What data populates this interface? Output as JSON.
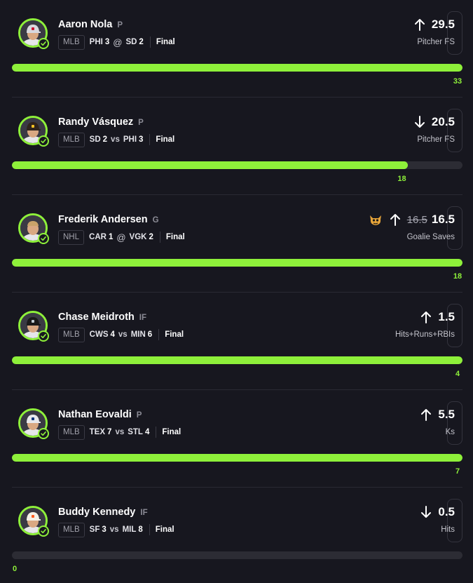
{
  "colors": {
    "background": "#17171f",
    "accent": "#8ef03a",
    "track": "#2c2c34",
    "box_border": "#34343e"
  },
  "cards": [
    {
      "player": "Aaron Nola",
      "position": "P",
      "league": "MLB",
      "team1": "PHI",
      "score1": "3",
      "separator": "@",
      "team2": "SD",
      "score2": "2",
      "status": "Final",
      "direction": "up",
      "direction_icon": "arrow-up-icon",
      "old_line": "",
      "line": "29.5",
      "stat": "Pitcher FS",
      "result": "33",
      "progress": 1.0,
      "headshot": "player-headshot-phillies-cap",
      "cap_color": "#d8d8de",
      "cap_accent": "#c8102e"
    },
    {
      "player": "Randy Vásquez",
      "position": "P",
      "league": "MLB",
      "team1": "SD",
      "score1": "2",
      "separator": "vs",
      "team2": "PHI",
      "score2": "3",
      "status": "Final",
      "direction": "down",
      "direction_icon": "arrow-down-icon",
      "old_line": "",
      "line": "20.5",
      "stat": "Pitcher FS",
      "result": "18",
      "progress": 0.878,
      "headshot": "player-headshot-padres-cap",
      "cap_color": "#2f241d",
      "cap_accent": "#ffc425"
    },
    {
      "player": "Frederik Andersen",
      "position": "G",
      "league": "NHL",
      "team1": "CAR",
      "score1": "1",
      "separator": "@",
      "team2": "VGK",
      "score2": "2",
      "status": "Final",
      "direction": "up",
      "direction_icon": "arrow-up-icon",
      "old_line": "16.5",
      "line": "16.5",
      "stat": "Goalie Saves",
      "result": "18",
      "progress": 1.0,
      "headshot": "player-headshot-no-cap",
      "cap_color": "",
      "cap_accent": "",
      "badge": "mascot-icon"
    },
    {
      "player": "Chase Meidroth",
      "position": "IF",
      "league": "MLB",
      "team1": "CWS",
      "score1": "4",
      "separator": "vs",
      "team2": "MIN",
      "score2": "6",
      "status": "Final",
      "direction": "up",
      "direction_icon": "arrow-up-icon",
      "old_line": "",
      "line": "1.5",
      "stat": "Hits+Runs+RBIs",
      "result": "4",
      "progress": 1.0,
      "headshot": "player-headshot-white-sox-cap",
      "cap_color": "#1a1a1a",
      "cap_accent": "#c4ced4"
    },
    {
      "player": "Nathan Eovaldi",
      "position": "P",
      "league": "MLB",
      "team1": "TEX",
      "score1": "7",
      "separator": "vs",
      "team2": "STL",
      "score2": "4",
      "status": "Final",
      "direction": "up",
      "direction_icon": "arrow-up-icon",
      "old_line": "",
      "line": "5.5",
      "stat": "Ks",
      "result": "7",
      "progress": 1.0,
      "headshot": "player-headshot-rangers-cap",
      "cap_color": "#e8e8ec",
      "cap_accent": "#003278"
    },
    {
      "player": "Buddy Kennedy",
      "position": "IF",
      "league": "MLB",
      "team1": "SF",
      "score1": "3",
      "separator": "vs",
      "team2": "MIL",
      "score2": "8",
      "status": "Final",
      "direction": "down",
      "direction_icon": "arrow-down-icon",
      "old_line": "",
      "line": "0.5",
      "stat": "Hits",
      "result": "0",
      "progress": 0.0,
      "headshot": "player-headshot-giants-cap",
      "cap_color": "#f4f1e8",
      "cap_accent": "#fd5a1e"
    }
  ]
}
